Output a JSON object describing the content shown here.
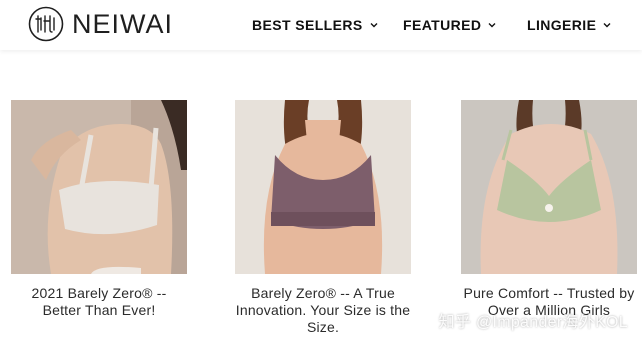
{
  "brand": {
    "name": "NEIWAI"
  },
  "nav": {
    "items": [
      {
        "label": "BEST SELLERS"
      },
      {
        "label": "FEATURED"
      },
      {
        "label": "LINGERIE"
      }
    ]
  },
  "products": [
    {
      "title": "2021 Barely Zero® -- Better Than Ever!",
      "color": "#d6cfc7"
    },
    {
      "title": "Barely Zero® -- A True Innovation. Your Size is the Size.",
      "color": "#8a6b78"
    },
    {
      "title": "Pure Comfort -- Trusted by Over a Million Girls",
      "color": "#b5c19a"
    }
  ],
  "watermark": "知乎 @Impander海外KOL"
}
